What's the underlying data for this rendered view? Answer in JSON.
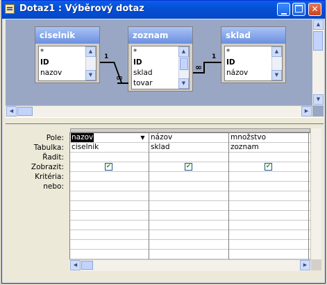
{
  "window": {
    "title": "Dotaz1 : Výběrový dotaz"
  },
  "tables": [
    {
      "name": "ciselnik",
      "fields": [
        "*",
        "ID",
        "nazov"
      ]
    },
    {
      "name": "zoznam",
      "fields": [
        "*",
        "ID",
        "sklad",
        "tovar"
      ]
    },
    {
      "name": "sklad",
      "fields": [
        "*",
        "ID",
        "názov"
      ]
    }
  ],
  "relations": [
    {
      "left_label": "1",
      "right_label": "∞"
    },
    {
      "left_label": "∞",
      "right_label": "1"
    }
  ],
  "grid": {
    "row_labels": [
      "Pole:",
      "Tabulka:",
      "Řadit:",
      "Zobrazit:",
      "Kritéria:",
      "nebo:"
    ],
    "columns": [
      {
        "field": "nazov",
        "table": "ciselnik",
        "show": true
      },
      {
        "field": "názov",
        "table": "sklad",
        "show": true
      },
      {
        "field": "množstvo",
        "table": "zoznam",
        "show": true
      }
    ]
  }
}
